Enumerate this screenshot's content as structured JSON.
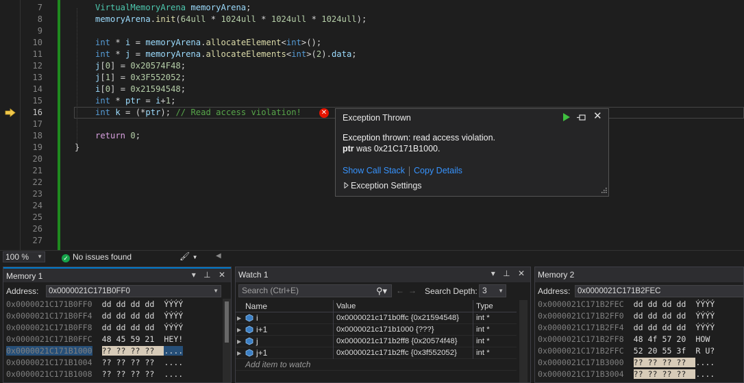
{
  "editor": {
    "lines": [
      {
        "num": "7",
        "tokens": [
          [
            "t-type",
            "VirtualMemoryArena"
          ],
          [
            "t-op",
            " "
          ],
          [
            "t-var",
            "memoryArena"
          ],
          [
            "t-punct",
            ";"
          ]
        ]
      },
      {
        "num": "8",
        "tokens": [
          [
            "t-var",
            "memoryArena"
          ],
          [
            "t-punct",
            "."
          ],
          [
            "t-fn",
            "init"
          ],
          [
            "t-punct",
            "("
          ],
          [
            "t-num",
            "64ull"
          ],
          [
            "t-op",
            " * "
          ],
          [
            "t-num",
            "1024ull"
          ],
          [
            "t-op",
            " * "
          ],
          [
            "t-num",
            "1024ull"
          ],
          [
            "t-op",
            " * "
          ],
          [
            "t-num",
            "1024ull"
          ],
          [
            "t-punct",
            ");"
          ]
        ]
      },
      {
        "num": "9",
        "tokens": []
      },
      {
        "num": "10",
        "tokens": [
          [
            "t-kw",
            "int"
          ],
          [
            "t-op",
            " * "
          ],
          [
            "t-var",
            "i"
          ],
          [
            "t-op",
            " = "
          ],
          [
            "t-var",
            "memoryArena"
          ],
          [
            "t-punct",
            "."
          ],
          [
            "t-fn",
            "allocateElement"
          ],
          [
            "t-punct",
            "<"
          ],
          [
            "t-kw",
            "int"
          ],
          [
            "t-punct",
            ">();"
          ]
        ]
      },
      {
        "num": "11",
        "tokens": [
          [
            "t-kw",
            "int"
          ],
          [
            "t-op",
            " * "
          ],
          [
            "t-var",
            "j"
          ],
          [
            "t-op",
            " = "
          ],
          [
            "t-var",
            "memoryArena"
          ],
          [
            "t-punct",
            "."
          ],
          [
            "t-fn",
            "allocateElements"
          ],
          [
            "t-punct",
            "<"
          ],
          [
            "t-kw",
            "int"
          ],
          [
            "t-punct",
            ">("
          ],
          [
            "t-num",
            "2"
          ],
          [
            "t-punct",
            ")."
          ],
          [
            "t-var",
            "data"
          ],
          [
            "t-punct",
            ";"
          ]
        ]
      },
      {
        "num": "12",
        "tokens": [
          [
            "t-var",
            "j"
          ],
          [
            "t-punct",
            "["
          ],
          [
            "t-num",
            "0"
          ],
          [
            "t-punct",
            "]"
          ],
          [
            "t-op",
            " = "
          ],
          [
            "t-num",
            "0x20574F48"
          ],
          [
            "t-punct",
            ";"
          ]
        ]
      },
      {
        "num": "13",
        "tokens": [
          [
            "t-var",
            "j"
          ],
          [
            "t-punct",
            "["
          ],
          [
            "t-num",
            "1"
          ],
          [
            "t-punct",
            "]"
          ],
          [
            "t-op",
            " = "
          ],
          [
            "t-num",
            "0x3F552052"
          ],
          [
            "t-punct",
            ";"
          ]
        ]
      },
      {
        "num": "14",
        "tokens": [
          [
            "t-var",
            "i"
          ],
          [
            "t-punct",
            "["
          ],
          [
            "t-num",
            "0"
          ],
          [
            "t-punct",
            "]"
          ],
          [
            "t-op",
            " = "
          ],
          [
            "t-num",
            "0x21594548"
          ],
          [
            "t-punct",
            ";"
          ]
        ]
      },
      {
        "num": "15",
        "tokens": [
          [
            "t-kw",
            "int"
          ],
          [
            "t-op",
            " * "
          ],
          [
            "t-var",
            "ptr"
          ],
          [
            "t-op",
            " = "
          ],
          [
            "t-var",
            "i"
          ],
          [
            "t-op",
            "+"
          ],
          [
            "t-num",
            "1"
          ],
          [
            "t-punct",
            ";"
          ]
        ]
      },
      {
        "num": "16",
        "tokens": [
          [
            "t-kw",
            "int"
          ],
          [
            "t-op",
            " "
          ],
          [
            "t-var",
            "k"
          ],
          [
            "t-op",
            " = "
          ],
          [
            "t-punct",
            "(*"
          ],
          [
            "t-var",
            "ptr"
          ],
          [
            "t-punct",
            ");"
          ],
          [
            "t-op",
            " "
          ],
          [
            "t-cm",
            "// Read access violation!"
          ]
        ]
      },
      {
        "num": "17",
        "tokens": []
      },
      {
        "num": "18",
        "tokens": [
          [
            "t-ret",
            "return"
          ],
          [
            "t-op",
            " "
          ],
          [
            "t-num",
            "0"
          ],
          [
            "t-punct",
            ";"
          ]
        ]
      },
      {
        "num": "19",
        "tokens": [
          [
            "t-punct",
            "}"
          ]
        ]
      },
      {
        "num": "20",
        "tokens": []
      },
      {
        "num": "21",
        "tokens": []
      },
      {
        "num": "22",
        "tokens": []
      },
      {
        "num": "23",
        "tokens": []
      },
      {
        "num": "24",
        "tokens": []
      },
      {
        "num": "25",
        "tokens": []
      },
      {
        "num": "26",
        "tokens": []
      },
      {
        "num": "27",
        "tokens": []
      }
    ],
    "current_line": "16"
  },
  "exception": {
    "title": "Exception Thrown",
    "message": "Exception thrown: read access violation.",
    "detail_var": "ptr",
    "detail_text": " was 0x21C171B1000.",
    "link_call_stack": "Show Call Stack",
    "link_copy": "Copy Details",
    "settings_label": "Exception Settings",
    "close_glyph": "✕"
  },
  "status": {
    "zoom": "100 %",
    "issues": "No issues found"
  },
  "memory1": {
    "title": "Memory 1",
    "address_label": "Address:",
    "address_value": "0x0000021C171B0FF0",
    "rows": [
      {
        "addr": "0x0000021C171B0FF0",
        "bytes": "dd dd dd dd",
        "ascii": "ÝÝÝÝ",
        "unknown": false,
        "selected": false
      },
      {
        "addr": "0x0000021C171B0FF4",
        "bytes": "dd dd dd dd",
        "ascii": "ÝÝÝÝ",
        "unknown": false,
        "selected": false
      },
      {
        "addr": "0x0000021C171B0FF8",
        "bytes": "dd dd dd dd",
        "ascii": "ÝÝÝÝ",
        "unknown": false,
        "selected": false
      },
      {
        "addr": "0x0000021C171B0FFC",
        "bytes": "48 45 59 21",
        "ascii": "HEY!",
        "unknown": false,
        "selected": false
      },
      {
        "addr": "0x0000021C171B1000",
        "bytes": "?? ?? ?? ??",
        "ascii": "....",
        "unknown": true,
        "selected": true
      },
      {
        "addr": "0x0000021C171B1004",
        "bytes": "?? ?? ?? ??",
        "ascii": "....",
        "unknown": false,
        "selected": false
      },
      {
        "addr": "0x0000021C171B1008",
        "bytes": "?? ?? ?? ??",
        "ascii": "....",
        "unknown": false,
        "selected": false
      }
    ]
  },
  "watch1": {
    "title": "Watch 1",
    "search_placeholder": "Search (Ctrl+E)",
    "depth_label": "Search Depth:",
    "depth_value": "3",
    "col_name": "Name",
    "col_value": "Value",
    "col_type": "Type",
    "rows": [
      {
        "name": "i",
        "value": "0x0000021c171b0ffc {0x21594548}",
        "type": "int *"
      },
      {
        "name": "i+1",
        "value": "0x0000021c171b1000 {???}",
        "type": "int *"
      },
      {
        "name": "j",
        "value": "0x0000021c171b2ff8 {0x20574f48}",
        "type": "int *"
      },
      {
        "name": "j+1",
        "value": "0x0000021c171b2ffc {0x3f552052}",
        "type": "int *"
      }
    ],
    "add_item": "Add item to watch"
  },
  "memory2": {
    "title": "Memory 2",
    "address_label": "Address:",
    "address_value": "0x0000021C171B2FEC",
    "rows": [
      {
        "addr": "0x0000021C171B2FEC",
        "bytes": "dd dd dd dd",
        "ascii": "ÝÝÝÝ",
        "unknown": false
      },
      {
        "addr": "0x0000021C171B2FF0",
        "bytes": "dd dd dd dd",
        "ascii": "ÝÝÝÝ",
        "unknown": false
      },
      {
        "addr": "0x0000021C171B2FF4",
        "bytes": "dd dd dd dd",
        "ascii": "ÝÝÝÝ",
        "unknown": false
      },
      {
        "addr": "0x0000021C171B2FF8",
        "bytes": "48 4f 57 20",
        "ascii": "HOW ",
        "unknown": false
      },
      {
        "addr": "0x0000021C171B2FFC",
        "bytes": "52 20 55 3f",
        "ascii": "R U?",
        "unknown": false
      },
      {
        "addr": "0x0000021C171B3000",
        "bytes": "?? ?? ?? ??",
        "ascii": "....",
        "unknown": true
      },
      {
        "addr": "0x0000021C171B3004",
        "bytes": "?? ?? ?? ??",
        "ascii": "....",
        "unknown": true
      }
    ]
  },
  "colors": {
    "accent": "#007acc",
    "change_bar": "#1f8a1f",
    "link": "#3794ff",
    "error": "#e51400"
  }
}
